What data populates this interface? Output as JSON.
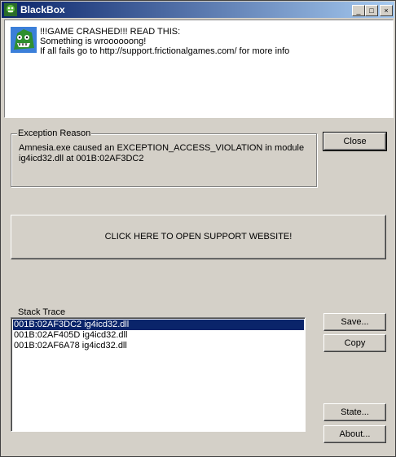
{
  "window": {
    "title": "BlackBox"
  },
  "message": {
    "lines": [
      "!!!GAME CRASHED!!! READ THIS:",
      "Something is wroooooong!",
      "If all fails go to http://support.frictionalgames.com/ for more info"
    ]
  },
  "exception": {
    "legend": "Exception Reason",
    "line1": "Amnesia.exe caused an EXCEPTION_ACCESS_VIOLATION in module",
    "line2": "ig4icd32.dll at 001B:02AF3DC2"
  },
  "buttons": {
    "close": "Close",
    "support": "CLICK HERE TO OPEN SUPPORT WEBSITE!",
    "save": "Save...",
    "copy": "Copy",
    "state": "State...",
    "about": "About..."
  },
  "stack": {
    "legend": "Stack Trace",
    "rows": [
      "001B:02AF3DC2 ig4icd32.dll",
      "001B:02AF405D ig4icd32.dll",
      "001B:02AF6A78 ig4icd32.dll"
    ],
    "selected_index": 0
  },
  "colors": {
    "titlebar": "#0a246a",
    "selection": "#0a246a",
    "face": "#d4d0c8"
  }
}
